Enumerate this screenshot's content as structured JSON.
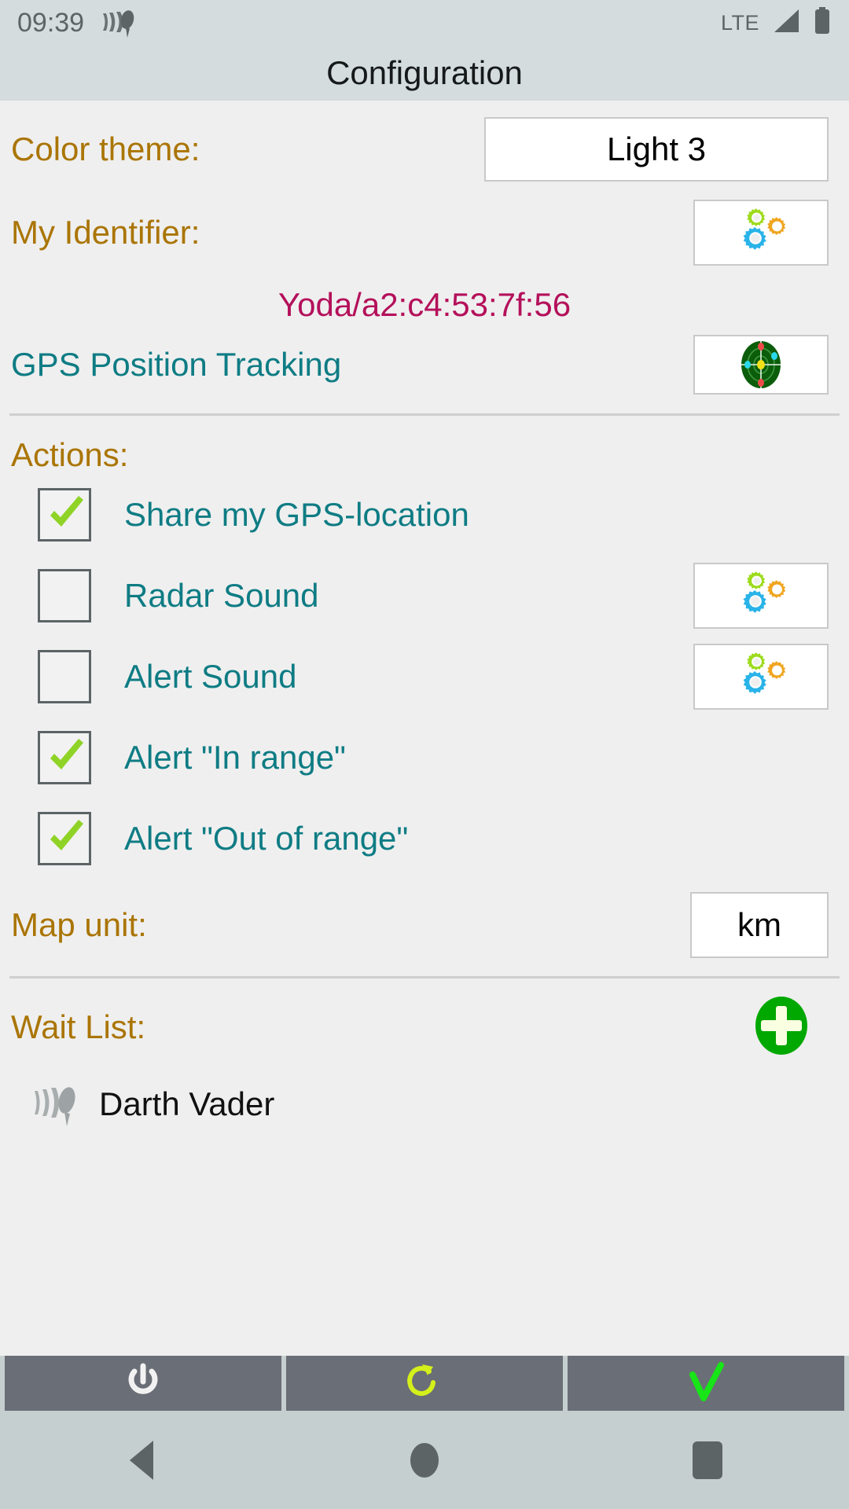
{
  "statusbar": {
    "time": "09:39",
    "left_icon": "satellite-dish-icon",
    "network_label": "LTE",
    "signal_icon": "signal-bars-icon",
    "battery_icon": "battery-full-icon"
  },
  "header": {
    "title": "Configuration"
  },
  "settings": {
    "color_theme": {
      "label": "Color theme:",
      "value": "Light 3"
    },
    "my_identifier": {
      "label": "My Identifier:",
      "button_icon": "gears-icon",
      "value": "Yoda/a2:c4:53:7f:56"
    },
    "gps_position_tracking": {
      "label": "GPS Position Tracking",
      "button_icon": "radar-icon"
    },
    "map_unit": {
      "label": "Map unit:",
      "value": "km"
    }
  },
  "actions": {
    "title": "Actions:",
    "items": [
      {
        "label": "Share my GPS-location",
        "checked": true,
        "has_settings": false,
        "settings_icon": ""
      },
      {
        "label": "Radar Sound",
        "checked": false,
        "has_settings": true,
        "settings_icon": "gears-icon"
      },
      {
        "label": "Alert Sound",
        "checked": false,
        "has_settings": true,
        "settings_icon": "gears-icon"
      },
      {
        "label": "Alert \"In range\"",
        "checked": true,
        "has_settings": false,
        "settings_icon": ""
      },
      {
        "label": "Alert \"Out of range\"",
        "checked": true,
        "has_settings": false,
        "settings_icon": ""
      }
    ]
  },
  "wait_list": {
    "title": "Wait List:",
    "add_icon": "plus-circle-icon",
    "entries": [
      {
        "icon": "satellite-dish-icon",
        "name": "Darth Vader"
      }
    ]
  },
  "toolbar": {
    "buttons": [
      {
        "name": "power-button",
        "icon": "power-icon",
        "color": "#f2f2f2"
      },
      {
        "name": "refresh-button",
        "icon": "refresh-icon",
        "color": "#d4f01a"
      },
      {
        "name": "confirm-button",
        "icon": "checkmark-icon",
        "color": "#17e517"
      }
    ]
  },
  "navbar": {
    "back": "back-triangle-icon",
    "home": "home-circle-icon",
    "recents": "recents-square-icon"
  },
  "colors": {
    "statusbar_bg": "#d5dcdd",
    "content_bg": "#efefef",
    "label_gold": "#aa7504",
    "label_teal": "#0e7c84",
    "identifier_magenta": "#b4105a",
    "check_green": "#8fd327",
    "toolbar_btn": "#6a6e76"
  }
}
